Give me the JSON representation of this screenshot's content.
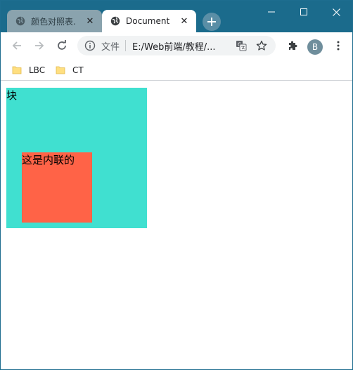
{
  "browser": {
    "tabs": [
      {
        "title": "颜色对照表.",
        "active": false
      },
      {
        "title": "Document",
        "active": true
      }
    ],
    "address_bar": {
      "scheme_label": "文件",
      "url": "E:/Web前端/教程/..."
    },
    "profile_initial": "B",
    "bookmarks": [
      "LBC",
      "CT"
    ]
  },
  "page": {
    "block_text": "块",
    "inline_text": "这是内联的"
  },
  "colors": {
    "titlebar": "#1b6b8c",
    "block_bg": "#40e0d0",
    "inline_bg": "#ff6347"
  },
  "icons": {
    "tab": "globe-icon",
    "back": "back-arrow-icon",
    "forward": "forward-arrow-icon",
    "reload": "reload-icon",
    "info": "info-icon",
    "translate": "translate-icon",
    "bookmark_star": "star-icon",
    "extensions": "puzzle-icon",
    "menu": "kebab-menu-icon",
    "bookmark_folder": "folder-icon"
  }
}
